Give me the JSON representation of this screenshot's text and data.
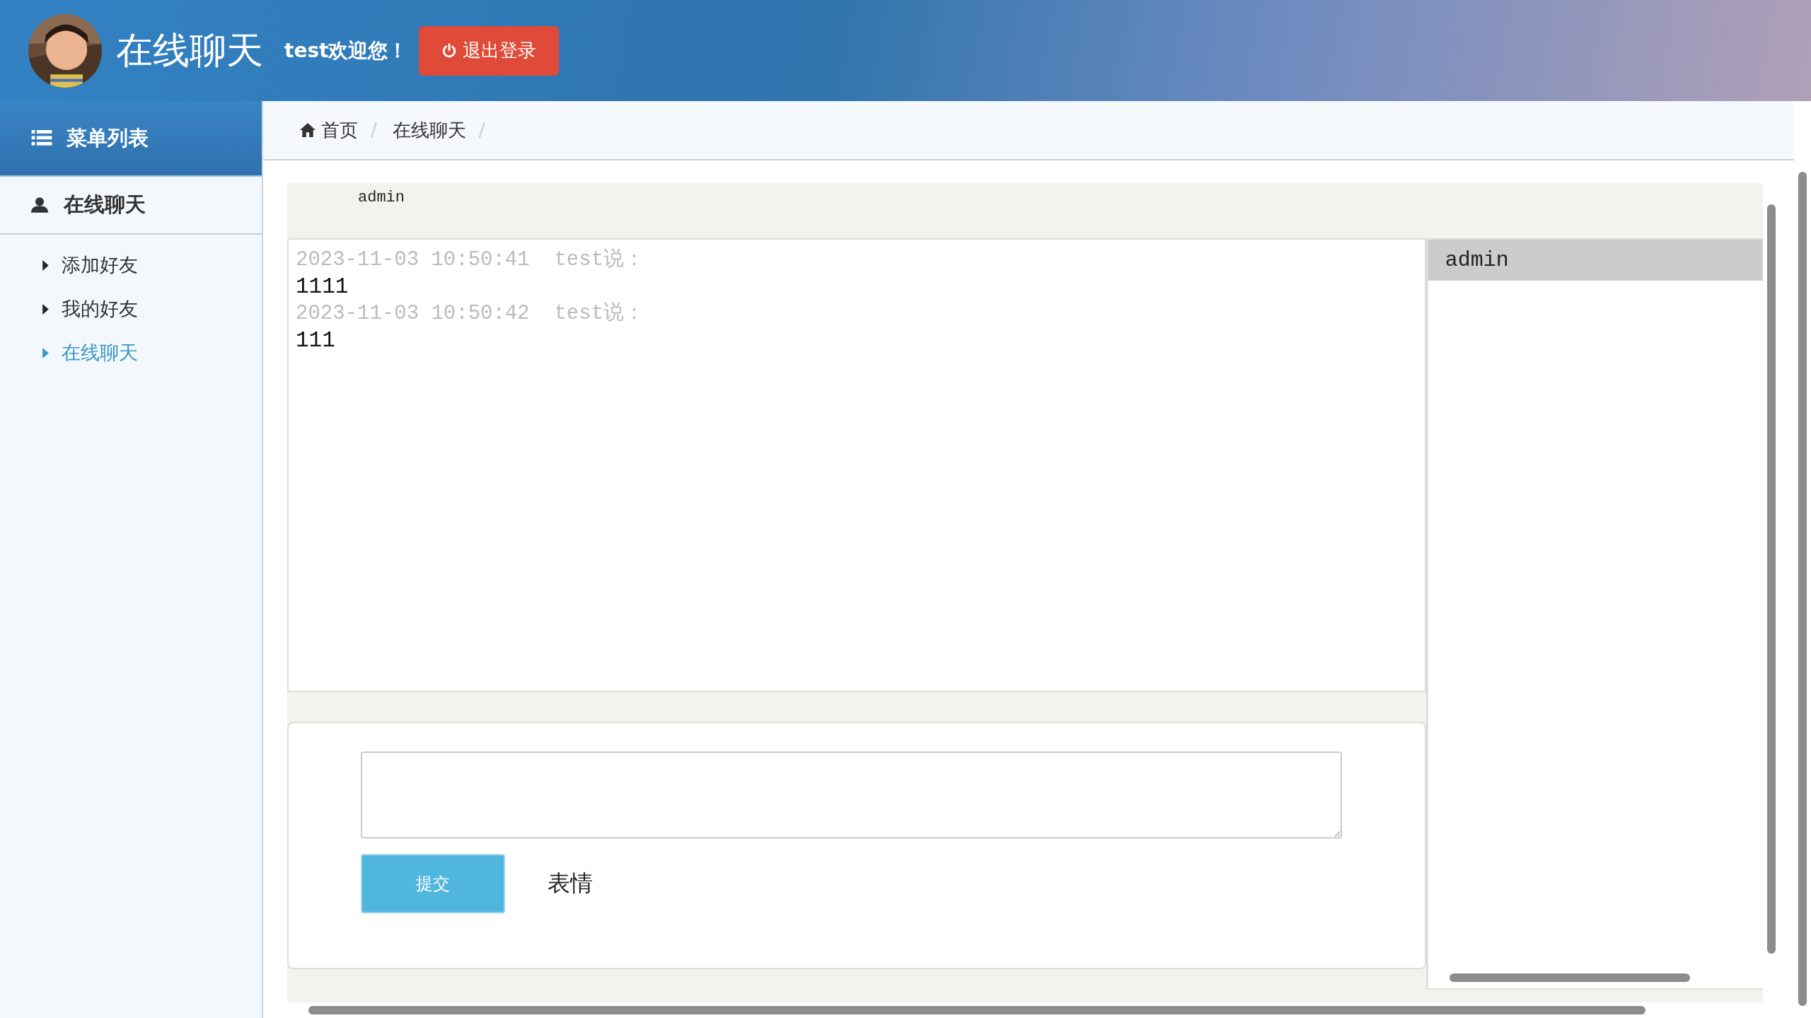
{
  "header": {
    "title": "在线聊天",
    "welcome": "test欢迎您！",
    "logout_button": "退出登录"
  },
  "sidebar": {
    "heading": "菜单列表",
    "section": "在线聊天",
    "items": [
      {
        "label": "添加好友",
        "selected": false
      },
      {
        "label": "我的好友",
        "selected": false
      },
      {
        "label": "在线聊天",
        "selected": true
      }
    ]
  },
  "breadcrumb": [
    {
      "label": "首页",
      "kind": "home",
      "separator": "/"
    },
    {
      "label": "在线聊天",
      "kind": "page",
      "separator": "/"
    }
  ],
  "chat": {
    "contact_name": "admin",
    "messages": [
      {
        "meta": "2023-11-03 10:50:41  test说：",
        "text": "1111"
      },
      {
        "meta": "2023-11-03 10:50:42  test说：",
        "text": "111"
      }
    ],
    "submit_button": "提交",
    "emoji_link": "表情"
  },
  "contacts": [
    {
      "name": "admin",
      "selected": true
    }
  ]
}
